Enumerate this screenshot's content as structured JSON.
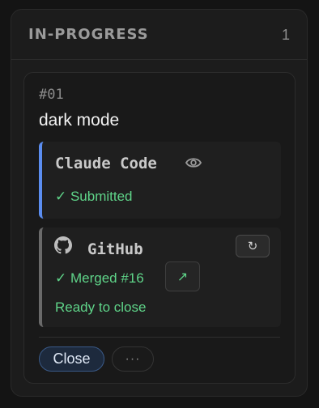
{
  "column": {
    "title": "IN-PROGRESS",
    "count": "1"
  },
  "card": {
    "id": "#01",
    "title": "dark mode",
    "agent": {
      "name": "Claude Code",
      "status": "✓ Submitted",
      "icon": "eye-icon"
    },
    "github": {
      "name": "GitHub",
      "icon": "github-icon",
      "merged": "✓ Merged #16",
      "ready": "Ready to close",
      "refresh_glyph": "↻",
      "open_glyph": "↗"
    },
    "actions": {
      "close_label": "Close",
      "more_label": "···"
    }
  },
  "colors": {
    "agent_accent": "#5b8df0",
    "success": "#5fd489",
    "primary_button_border": "#3a5a88"
  }
}
